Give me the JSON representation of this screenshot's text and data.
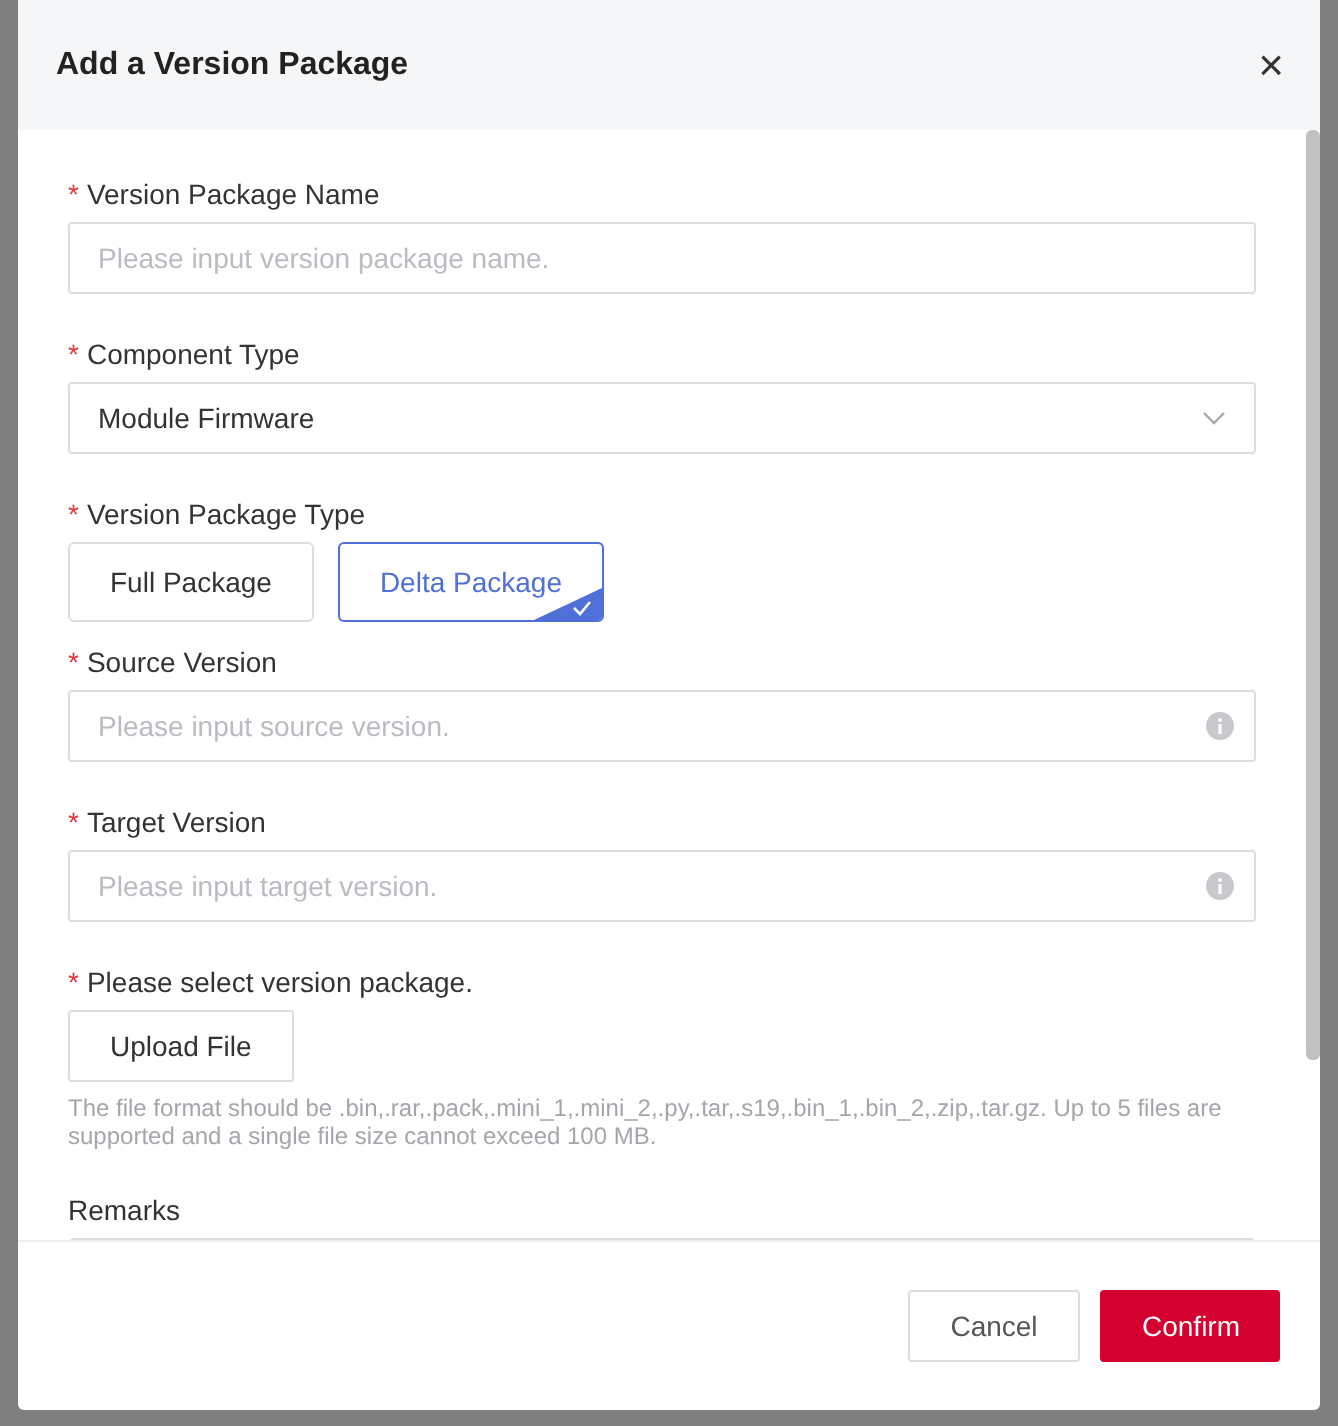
{
  "dialog": {
    "title": "Add a Version Package",
    "close": "×"
  },
  "fields": [
    {
      "kind": "text",
      "mark": "*",
      "label": "Version Package Name",
      "placeholder": "Please input version package name.",
      "info": false
    },
    {
      "kind": "select",
      "mark": "*",
      "label": "Component Type",
      "value": "Module Firmware"
    },
    {
      "kind": "choice",
      "mark": "*",
      "label": "Version Package Type",
      "options": [
        {
          "label": "Full Package",
          "selected": false
        },
        {
          "label": "Delta Package",
          "selected": true
        }
      ]
    },
    {
      "kind": "text",
      "mark": "*",
      "label": "Source Version",
      "placeholder": "Please input source version.",
      "info": true
    },
    {
      "kind": "text",
      "mark": "*",
      "label": "Target Version",
      "placeholder": "Please input target version.",
      "info": true
    },
    {
      "kind": "upload",
      "mark": "*",
      "label": "Please select version package.",
      "button": "Upload File",
      "hint": "The file format should be .bin,.rar,.pack,.mini_1,.mini_2,.py,.tar,.s19,.bin_1,.bin_2,.zip,.tar.gz. Up to 5 files are supported and a single file size cannot exceed 100 MB."
    },
    {
      "kind": "textarea",
      "label": "Remarks"
    }
  ],
  "buttons": [
    {
      "label": "Cancel",
      "kind": "secondary"
    },
    {
      "label": "Confirm",
      "kind": "primary"
    }
  ]
}
